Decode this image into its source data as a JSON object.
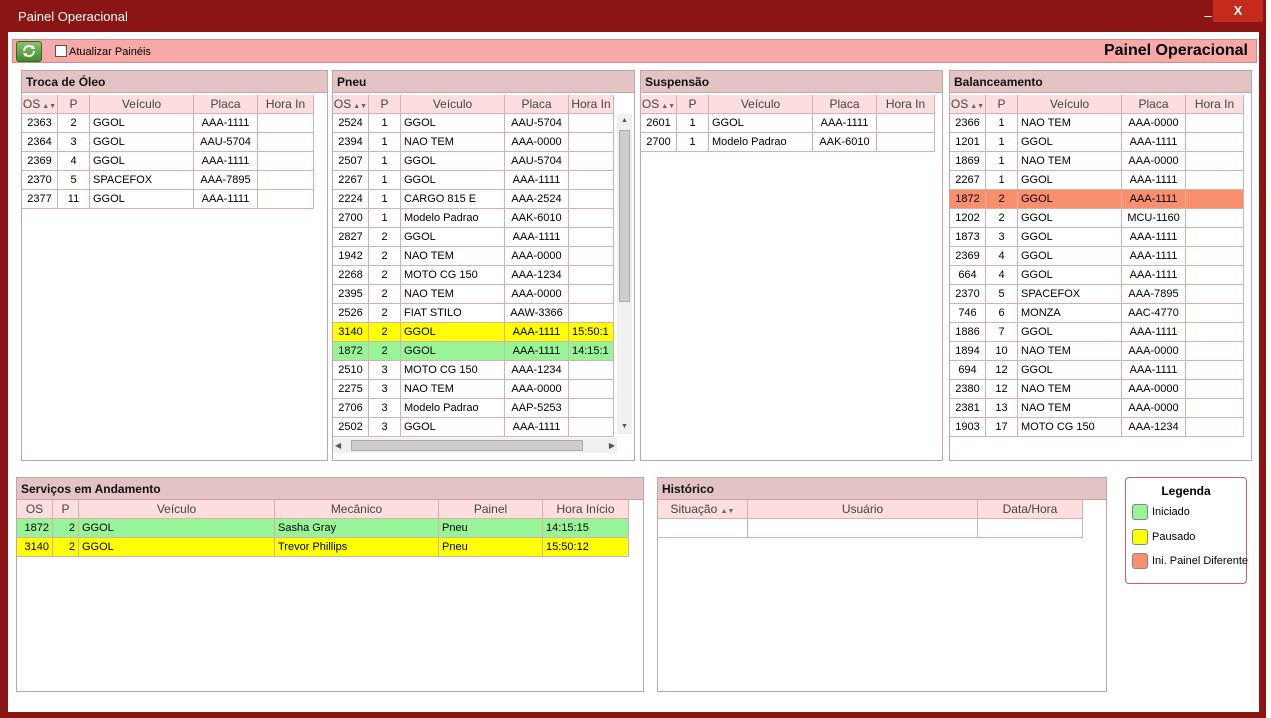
{
  "window": {
    "title": "Painel Operacional",
    "minimize_label": "–",
    "close_label": "X"
  },
  "toolbar": {
    "refresh_icon": "refresh-icon",
    "auto_refresh_label": "Atualizar Painéis",
    "auto_refresh_checked": false,
    "title": "Painel Operacional"
  },
  "colors": {
    "started": "#97f597",
    "paused": "#ffff00",
    "different_panel": "#fa8f6e",
    "titlebar": "#8b1515"
  },
  "columns": {
    "os": "OS",
    "p": "P",
    "vehicle": "Veículo",
    "plate": "Placa",
    "time_in": "Hora In"
  },
  "troca_oleo": {
    "title": "Troca de Óleo",
    "rows": [
      {
        "os": "2363",
        "p": "2",
        "vehicle": "GGOL",
        "plate": "AAA-1111",
        "time": ""
      },
      {
        "os": "2364",
        "p": "3",
        "vehicle": "GGOL",
        "plate": "AAU-5704",
        "time": ""
      },
      {
        "os": "2369",
        "p": "4",
        "vehicle": "GGOL",
        "plate": "AAA-1111",
        "time": ""
      },
      {
        "os": "2370",
        "p": "5",
        "vehicle": "SPACEFOX",
        "plate": "AAA-7895",
        "time": ""
      },
      {
        "os": "2377",
        "p": "11",
        "vehicle": "GGOL",
        "plate": "AAA-1111",
        "time": ""
      }
    ]
  },
  "pneu": {
    "title": "Pneu",
    "rows": [
      {
        "os": "2524",
        "p": "1",
        "vehicle": "GGOL",
        "plate": "AAU-5704",
        "time": ""
      },
      {
        "os": "2394",
        "p": "1",
        "vehicle": "NAO TEM",
        "plate": "AAA-0000",
        "time": ""
      },
      {
        "os": "2507",
        "p": "1",
        "vehicle": "GGOL",
        "plate": "AAU-5704",
        "time": ""
      },
      {
        "os": "2267",
        "p": "1",
        "vehicle": "GGOL",
        "plate": "AAA-1111",
        "time": ""
      },
      {
        "os": "2224",
        "p": "1",
        "vehicle": "CARGO 815 E",
        "plate": "AAA-2524",
        "time": ""
      },
      {
        "os": "2700",
        "p": "1",
        "vehicle": "Modelo Padrao",
        "plate": "AAK-6010",
        "time": ""
      },
      {
        "os": "2827",
        "p": "2",
        "vehicle": "GGOL",
        "plate": "AAA-1111",
        "time": ""
      },
      {
        "os": "1942",
        "p": "2",
        "vehicle": "NAO TEM",
        "plate": "AAA-0000",
        "time": ""
      },
      {
        "os": "2268",
        "p": "2",
        "vehicle": "MOTO CG 150",
        "plate": "AAA-1234",
        "time": ""
      },
      {
        "os": "2395",
        "p": "2",
        "vehicle": "NAO TEM",
        "plate": "AAA-0000",
        "time": ""
      },
      {
        "os": "2526",
        "p": "2",
        "vehicle": "FIAT STILO",
        "plate": "AAW-3366",
        "time": ""
      },
      {
        "os": "3140",
        "p": "2",
        "vehicle": "GGOL",
        "plate": "AAA-1111",
        "time": "15:50:1",
        "status": "paused"
      },
      {
        "os": "1872",
        "p": "2",
        "vehicle": "GGOL",
        "plate": "AAA-1111",
        "time": "14:15:1",
        "status": "started"
      },
      {
        "os": "2510",
        "p": "3",
        "vehicle": "MOTO CG 150",
        "plate": "AAA-1234",
        "time": ""
      },
      {
        "os": "2275",
        "p": "3",
        "vehicle": "NAO TEM",
        "plate": "AAA-0000",
        "time": ""
      },
      {
        "os": "2706",
        "p": "3",
        "vehicle": "Modelo Padrao",
        "plate": "AAP-5253",
        "time": ""
      },
      {
        "os": "2502",
        "p": "3",
        "vehicle": "GGOL",
        "plate": "AAA-1111",
        "time": ""
      }
    ]
  },
  "suspensao": {
    "title": "Suspensão",
    "rows": [
      {
        "os": "2601",
        "p": "1",
        "vehicle": "GGOL",
        "plate": "AAA-1111",
        "time": ""
      },
      {
        "os": "2700",
        "p": "1",
        "vehicle": "Modelo Padrao",
        "plate": "AAK-6010",
        "time": ""
      }
    ]
  },
  "balanceamento": {
    "title": "Balanceamento",
    "rows": [
      {
        "os": "2366",
        "p": "1",
        "vehicle": "NAO TEM",
        "plate": "AAA-0000",
        "time": ""
      },
      {
        "os": "1201",
        "p": "1",
        "vehicle": "GGOL",
        "plate": "AAA-1111",
        "time": ""
      },
      {
        "os": "1869",
        "p": "1",
        "vehicle": "NAO TEM",
        "plate": "AAA-0000",
        "time": ""
      },
      {
        "os": "2267",
        "p": "1",
        "vehicle": "GGOL",
        "plate": "AAA-1111",
        "time": ""
      },
      {
        "os": "1872",
        "p": "2",
        "vehicle": "GGOL",
        "plate": "AAA-1111",
        "time": "",
        "status": "different"
      },
      {
        "os": "1202",
        "p": "2",
        "vehicle": "GGOL",
        "plate": "MCU-1160",
        "time": ""
      },
      {
        "os": "1873",
        "p": "3",
        "vehicle": "GGOL",
        "plate": "AAA-1111",
        "time": ""
      },
      {
        "os": "2369",
        "p": "4",
        "vehicle": "GGOL",
        "plate": "AAA-1111",
        "time": ""
      },
      {
        "os": "664",
        "p": "4",
        "vehicle": "GGOL",
        "plate": "AAA-1111",
        "time": ""
      },
      {
        "os": "2370",
        "p": "5",
        "vehicle": "SPACEFOX",
        "plate": "AAA-7895",
        "time": ""
      },
      {
        "os": "746",
        "p": "6",
        "vehicle": "MONZA",
        "plate": "AAC-4770",
        "time": ""
      },
      {
        "os": "1886",
        "p": "7",
        "vehicle": "GGOL",
        "plate": "AAA-1111",
        "time": ""
      },
      {
        "os": "1894",
        "p": "10",
        "vehicle": "NAO TEM",
        "plate": "AAA-0000",
        "time": ""
      },
      {
        "os": "694",
        "p": "12",
        "vehicle": "GGOL",
        "plate": "AAA-1111",
        "time": ""
      },
      {
        "os": "2380",
        "p": "12",
        "vehicle": "NAO TEM",
        "plate": "AAA-0000",
        "time": ""
      },
      {
        "os": "2381",
        "p": "13",
        "vehicle": "NAO TEM",
        "plate": "AAA-0000",
        "time": ""
      },
      {
        "os": "1903",
        "p": "17",
        "vehicle": "MOTO CG 150",
        "plate": "AAA-1234",
        "time": ""
      }
    ]
  },
  "servicos": {
    "title": "Serviços em Andamento",
    "columns": {
      "os": "OS",
      "p": "P",
      "vehicle": "Veículo",
      "mechanic": "Mecânico",
      "panel": "Painel",
      "start": "Hora Início"
    },
    "rows": [
      {
        "os": "1872",
        "p": "2",
        "vehicle": "GGOL",
        "mechanic": "Sasha Gray",
        "panel": "Pneu",
        "start": "14:15:15",
        "status": "started"
      },
      {
        "os": "3140",
        "p": "2",
        "vehicle": "GGOL",
        "mechanic": "Trevor Phillips",
        "panel": "Pneu",
        "start": "15:50:12",
        "status": "paused"
      }
    ]
  },
  "historico": {
    "title": "Histórico",
    "columns": {
      "status": "Situação",
      "user": "Usuário",
      "datetime": "Data/Hora"
    }
  },
  "legenda": {
    "title": "Legenda",
    "items": [
      {
        "label": "Iniciado",
        "status": "started"
      },
      {
        "label": "Pausado",
        "status": "paused"
      },
      {
        "label": "Ini. Painel Diferente",
        "status": "different"
      }
    ]
  }
}
